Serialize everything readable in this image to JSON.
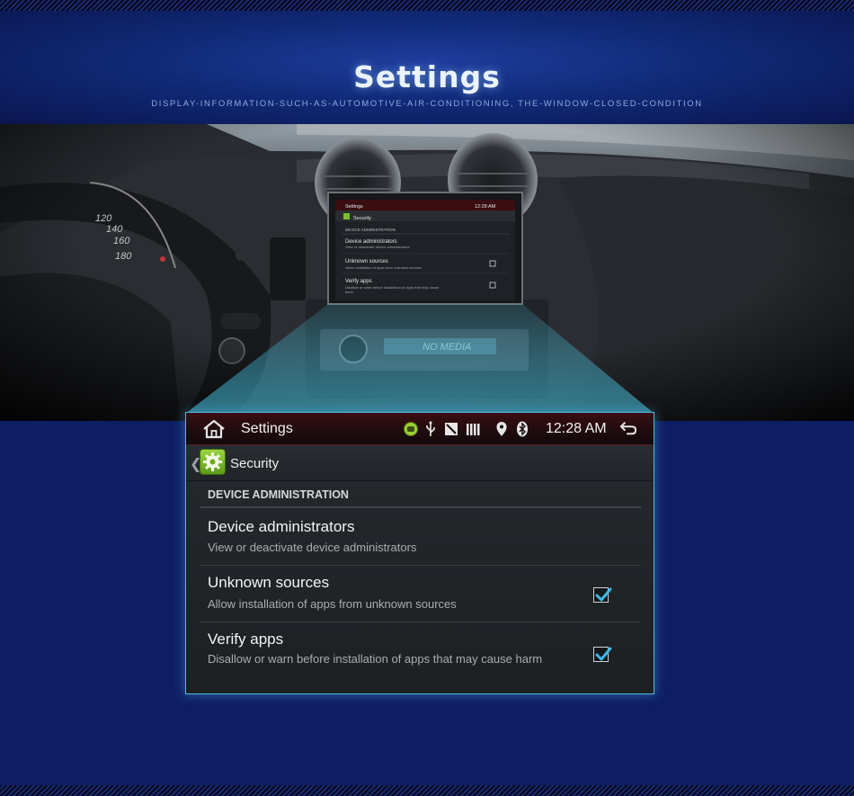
{
  "banner": {
    "title": "Settings",
    "subtitle": "DISPLAY-INFORMATION-SUCH-AS-AUTOMOTIVE-AIR-CONDITIONING, THE-WINDOW-CLOSED-CONDITION"
  },
  "scene": {
    "speedometer_ticks": [
      "120",
      "140",
      "160",
      "180"
    ],
    "stereo_label": "NO MEDIA"
  },
  "status_bar": {
    "app_title": "Settings",
    "clock": "12:28 AM",
    "icons": [
      "home-icon",
      "android-debug-icon",
      "usb-icon",
      "no-sim-icon",
      "signal-bars-icon",
      "location-pin-icon",
      "bluetooth-icon",
      "back-arrow-icon"
    ]
  },
  "breadcrumb": {
    "label": "Security",
    "icon": "gear-icon"
  },
  "security": {
    "section_header": "DEVICE ADMINISTRATION",
    "items": [
      {
        "title": "Device administrators",
        "subtitle": "View or deactivate device administrators",
        "checked": null
      },
      {
        "title": "Unknown sources",
        "subtitle": "Allow installation of apps from unknown sources",
        "checked": true
      },
      {
        "title": "Verify apps",
        "subtitle": "Disallow or warn before installation of apps that may cause harm",
        "checked": true
      }
    ]
  },
  "colors": {
    "background": "#0f1e63",
    "accent": "#4fb7d9",
    "status_bar": "#3a0d12",
    "checkmark": "#3fb8e8",
    "gear_badge": "#7cbd2a"
  }
}
